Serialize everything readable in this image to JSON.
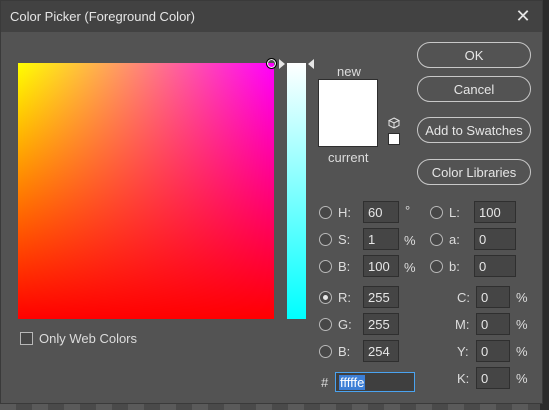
{
  "window": {
    "title": "Color Picker (Foreground Color)",
    "close_glyph": "✕"
  },
  "preview": {
    "new_label": "new",
    "current_label": "current",
    "new_color": "#ffffff",
    "current_color": "#ffffff"
  },
  "buttons": {
    "ok": "OK",
    "cancel": "Cancel",
    "add_to_swatches": "Add to Swatches",
    "color_libraries": "Color Libraries"
  },
  "hsb": {
    "h": {
      "label": "H:",
      "value": "60",
      "unit": "°"
    },
    "s": {
      "label": "S:",
      "value": "1",
      "unit": "%"
    },
    "b": {
      "label": "B:",
      "value": "100",
      "unit": "%"
    }
  },
  "lab": {
    "l": {
      "label": "L:",
      "value": "100"
    },
    "a": {
      "label": "a:",
      "value": "0"
    },
    "b": {
      "label": "b:",
      "value": "0"
    }
  },
  "rgb": {
    "r": {
      "label": "R:",
      "value": "255",
      "selected": true
    },
    "g": {
      "label": "G:",
      "value": "255"
    },
    "b": {
      "label": "B:",
      "value": "254"
    }
  },
  "cmyk": {
    "c": {
      "label": "C:",
      "value": "0",
      "unit": "%"
    },
    "m": {
      "label": "M:",
      "value": "0",
      "unit": "%"
    },
    "y": {
      "label": "Y:",
      "value": "0",
      "unit": "%"
    },
    "k": {
      "label": "K:",
      "value": "0",
      "unit": "%"
    }
  },
  "hex": {
    "prefix": "#",
    "value": "fffffe"
  },
  "only_web_colors": {
    "label": "Only Web Colors",
    "checked": false
  },
  "icons": [
    "close-icon",
    "cube-icon"
  ]
}
